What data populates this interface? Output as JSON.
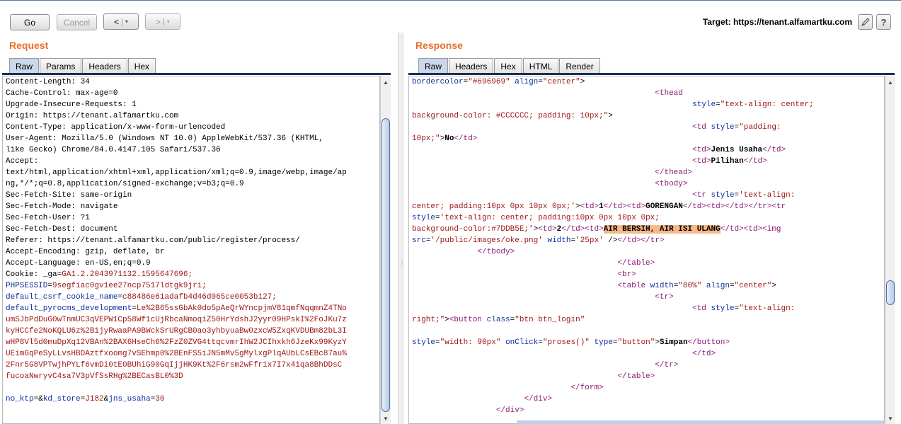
{
  "toolbar": {
    "go_label": "Go",
    "cancel_label": "Cancel",
    "back_label": "<",
    "forward_label": ">",
    "dropdown_glyph": "▾",
    "target_label": "Target: https://tenant.alfamartku.com",
    "edit_icon": "pencil-icon",
    "help_label": "?"
  },
  "request": {
    "title": "Request",
    "tabs": [
      "Raw",
      "Params",
      "Headers",
      "Hex"
    ],
    "active_tab": "Raw",
    "lines": [
      "Content-Length: 34",
      "Cache-Control: max-age=0",
      "Upgrade-Insecure-Requests: 1",
      "Origin: https://tenant.alfamartku.com",
      "Content-Type: application/x-www-form-urlencoded",
      "User-Agent: Mozilla/5.0 (Windows NT 10.0) AppleWebKit/537.36 (KHTML,",
      "like Gecko) Chrome/84.0.4147.105 Safari/537.36",
      "Accept:",
      "text/html,application/xhtml+xml,application/xml;q=0.9,image/webp,image/ap",
      "ng,*/*;q=0.8,application/signed-exchange;v=b3;q=0.9",
      "Sec-Fetch-Site: same-origin",
      "Sec-Fetch-Mode: navigate",
      "Sec-Fetch-User: ?1",
      "Sec-Fetch-Dest: document",
      "Referer: https://tenant.alfamartku.com/public/register/process/",
      "Accept-Encoding: gzip, deflate, br",
      "Accept-Language: en-US,en;q=0.9"
    ],
    "cookies": [
      {
        "key": "Cookie: _ga",
        "value": "GA1.2.2043971132.1595647696;"
      },
      {
        "key": "PHPSESSID",
        "value": "9segfiac0gv1ee27ncp7517ldtgk9jri;"
      },
      {
        "key": "default_csrf_cookie_name",
        "value": "c88486e61adafb4d46d065ce0053b127;"
      },
      {
        "key": "default_pyrocms_development",
        "value": "Le%2B65ssGbAk0do5pAeQrWYncpjmV81qmfNqqmnZ4TNo"
      }
    ],
    "cookie_continuation": [
      "umSJbPdDuG0wTnmUC3qVEPW1Cp58Wf1cUjRbcaNmoqiZ50HrYdshJ2yyr09HPskI%2FoJKu7z",
      "kyHCCfe2NoKQLU6z%2B1jyRwaaPA9BWckSrURgCB0ao3yhbyuaBw0zxcW5ZxqKVDUBm82bL3I",
      "wHP8Vl5d0muDpXq12VBAn%2BAX6HseCh6%2FzZ0ZVG4ttqcvmrIhW2JCIhxkh6JzeKx99KyzY",
      "UEimGqPeSyLLvsHBDAztfxoomg7vSEhmp0%2BEnFS5iJN5mMv5gMylxgPlqAUbLCsEBc87au%",
      "2Fnr5G8VPTwjhPYLf6vmDi0tE0BUhiG90GqIjjHK9Kt%2F6rsm2wFfr1x7I7x41qa8BhDDsC",
      "fucoaNwryvC4sa7V3pVfSsRHg%2BECasBL0%3D"
    ],
    "body_params": [
      {
        "key": "no_ktp",
        "value": ""
      },
      {
        "key": "kd_store",
        "value": "J182"
      },
      {
        "key": "jns_usaha",
        "value": "30"
      }
    ]
  },
  "response": {
    "title": "Response",
    "tabs": [
      "Raw",
      "Headers",
      "Hex",
      "HTML",
      "Render"
    ],
    "active_tab": "Raw",
    "highlight_text": "AIR BERSIH, AIR ISI ULANG"
  }
}
